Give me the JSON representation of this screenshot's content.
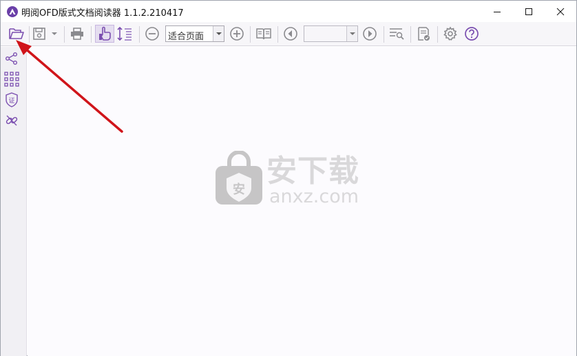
{
  "window": {
    "title": "明阅OFD版式文档阅读器 1.1.2.210417",
    "controls": [
      "minimize",
      "maximize",
      "close"
    ]
  },
  "toolbar": {
    "buttons": [
      {
        "name": "open-file",
        "icon": "folder-open-icon"
      },
      {
        "name": "save",
        "icon": "save-icon"
      },
      {
        "name": "save-dropdown",
        "icon": "chevron-down-icon"
      },
      {
        "name": "print",
        "icon": "printer-icon"
      },
      {
        "name": "hand-tool",
        "icon": "hand-pointer-icon"
      },
      {
        "name": "text-select",
        "icon": "text-select-icon"
      },
      {
        "name": "zoom-out",
        "icon": "zoom-out-icon"
      },
      {
        "name": "zoom-in",
        "icon": "zoom-in-icon"
      },
      {
        "name": "two-page-view",
        "icon": "book-icon"
      },
      {
        "name": "previous-page",
        "icon": "arrow-left-circle-icon"
      },
      {
        "name": "next-page",
        "icon": "arrow-right-circle-icon"
      },
      {
        "name": "find",
        "icon": "search-list-icon"
      },
      {
        "name": "verify-signature",
        "icon": "document-check-icon"
      },
      {
        "name": "settings",
        "icon": "gear-icon"
      },
      {
        "name": "help",
        "icon": "help-icon"
      }
    ],
    "zoom_value": "适合页面",
    "page_number": ""
  },
  "sidebar": {
    "items": [
      {
        "name": "share",
        "icon": "share-icon"
      },
      {
        "name": "thumbnails",
        "icon": "grid-icon"
      },
      {
        "name": "certificate",
        "icon": "shield-cert-icon"
      },
      {
        "name": "attachments",
        "icon": "link-icon"
      }
    ],
    "cert_glyph": "证"
  },
  "watermark": {
    "icon_glyph": "安",
    "text_cn": "安下载",
    "text_en": "anxz.com"
  },
  "colors": {
    "accent": "#7b4fb0",
    "toolbar_bg": "#f7f6f9",
    "sidebar_bg": "#f1f0f4",
    "doc_bg": "#fcfbfe",
    "arrow": "#d0141a"
  }
}
